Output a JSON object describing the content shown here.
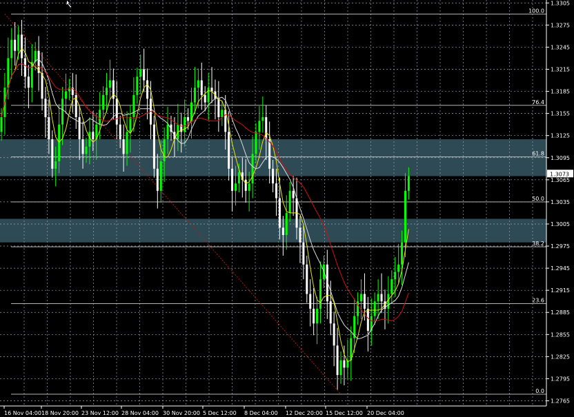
{
  "chart_data": {
    "type": "candlestick",
    "grid": true,
    "colors": {
      "background": "#000000",
      "axis": "#ffffff",
      "grid": "#9aa4b0",
      "bull_candle": "#00ff00",
      "bear_candle": "#ffffff",
      "ma_yellow": "#e8e800",
      "ma_white": "#dcdcdc",
      "ma_red": "#d01010",
      "zone": "#2e4a55",
      "level_line": "#cfcfcf",
      "diagonal": "#c01818"
    },
    "y_range": [
      1.2758,
      1.3309
    ],
    "y_ticks": [
      "1.3305",
      "1.3275",
      "1.3245",
      "1.3215",
      "1.3185",
      "1.3155",
      "1.3125",
      "1.3095",
      "1.3065",
      "1.3035",
      "1.3005",
      "1.2975",
      "1.2945",
      "1.2915",
      "1.2885",
      "1.2855",
      "1.2825",
      "1.2795",
      "1.2765"
    ],
    "x_ticks": [
      "16 Nov 04:00",
      "18 Nov 20:00",
      "23 Nov 12:00",
      "28 Nov 04:00",
      "30 Nov 20:00",
      "5 Dec 12:00",
      "8 Dec 04:00",
      "12 Dec 20:00",
      "15 Dec 12:00",
      "20 Dec 04:00"
    ],
    "current_price": "1.3073",
    "fib_levels": [
      {
        "label": "100.0",
        "price": 1.329
      },
      {
        "label": "76.4",
        "price": 1.3166
      },
      {
        "label": "61.8",
        "price": 1.3096
      },
      {
        "label": "50.0",
        "price": 1.3035
      },
      {
        "label": "38.2",
        "price": 1.2974
      },
      {
        "label": "23.6",
        "price": 1.2897
      },
      {
        "label": "0.0",
        "price": 1.2774
      }
    ],
    "zones": [
      {
        "from": 1.307,
        "to": 1.312
      },
      {
        "from": 1.298,
        "to": 1.3012
      }
    ],
    "diagonal_line": [
      [
        1,
        1.329
      ],
      [
        100,
        1.2774
      ]
    ],
    "closes": [
      1.315,
      1.319,
      1.323,
      1.3255,
      1.324,
      1.3262,
      1.323,
      1.3205,
      1.319,
      1.3225,
      1.324,
      1.321,
      1.3175,
      1.315,
      1.312,
      1.308,
      1.309,
      1.314,
      1.3175,
      1.3185,
      1.319,
      1.318,
      1.315,
      1.312,
      1.31,
      1.311,
      1.313,
      1.312,
      1.314,
      1.316,
      1.318,
      1.319,
      1.32,
      1.3175,
      1.314,
      1.312,
      1.31,
      1.313,
      1.315,
      1.318,
      1.3205,
      1.3215,
      1.32,
      1.3175,
      1.314,
      1.308,
      1.305,
      1.309,
      1.312,
      1.314,
      1.313,
      1.312,
      1.314,
      1.313,
      1.315,
      1.3145,
      1.317,
      1.319,
      1.32,
      1.318,
      1.317,
      1.319,
      1.3185,
      1.3175,
      1.315,
      1.316,
      1.313,
      1.308,
      1.305,
      1.306,
      1.3075,
      1.3065,
      1.305,
      1.306,
      1.31,
      1.313,
      1.3145,
      1.315,
      1.312,
      1.308,
      1.306,
      1.304,
      1.3,
      1.299,
      1.302,
      1.305,
      1.304,
      1.3,
      1.298,
      1.295,
      1.291,
      1.289,
      1.287,
      1.289,
      1.293,
      1.295,
      1.29,
      1.287,
      1.284,
      1.28,
      1.282,
      1.281,
      1.282,
      1.285,
      1.288,
      1.29,
      1.291,
      1.289,
      1.286,
      1.288,
      1.29,
      1.291,
      1.29,
      1.289,
      1.291,
      1.293,
      1.294,
      1.295,
      1.298,
      1.305,
      1.307
    ]
  }
}
